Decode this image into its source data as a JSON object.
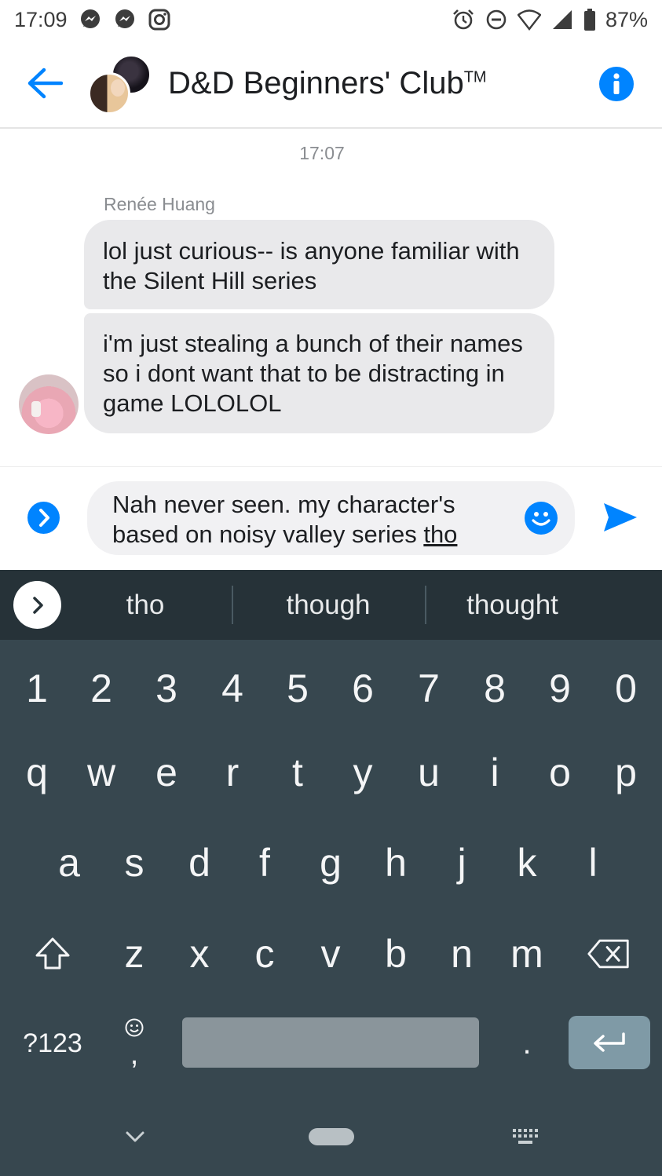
{
  "status_bar": {
    "time": "17:09",
    "battery": "87%",
    "left_icons": [
      "messenger-icon",
      "messenger-icon",
      "instagram-icon"
    ],
    "right_icons": [
      "alarm-icon",
      "do-not-disturb-icon",
      "wifi-icon",
      "signal-icon",
      "battery-icon"
    ]
  },
  "header": {
    "title": "D&D Beginners' Club",
    "title_mark": "TM",
    "accent_color": "#0084ff"
  },
  "conversation": {
    "timestamp": "17:07",
    "sender": "Renée Huang",
    "messages": [
      "lol just curious-- is anyone familiar with the Silent Hill series",
      "i'm just stealing a bunch of their names so i dont want that to be distracting in game LOLOLOL"
    ]
  },
  "composer": {
    "text_before": "Nah never seen. my character's based on noisy valley series ",
    "text_underlined": "tho"
  },
  "keyboard": {
    "suggestions": [
      "tho",
      "though",
      "thought"
    ],
    "number_row": [
      "1",
      "2",
      "3",
      "4",
      "5",
      "6",
      "7",
      "8",
      "9",
      "0"
    ],
    "row1": [
      "q",
      "w",
      "e",
      "r",
      "t",
      "y",
      "u",
      "i",
      "o",
      "p"
    ],
    "row2": [
      "a",
      "s",
      "d",
      "f",
      "g",
      "h",
      "j",
      "k",
      "l"
    ],
    "row3": [
      "z",
      "x",
      "c",
      "v",
      "b",
      "n",
      "m"
    ],
    "symbols_label": "?123",
    "comma": ",",
    "period": "."
  }
}
